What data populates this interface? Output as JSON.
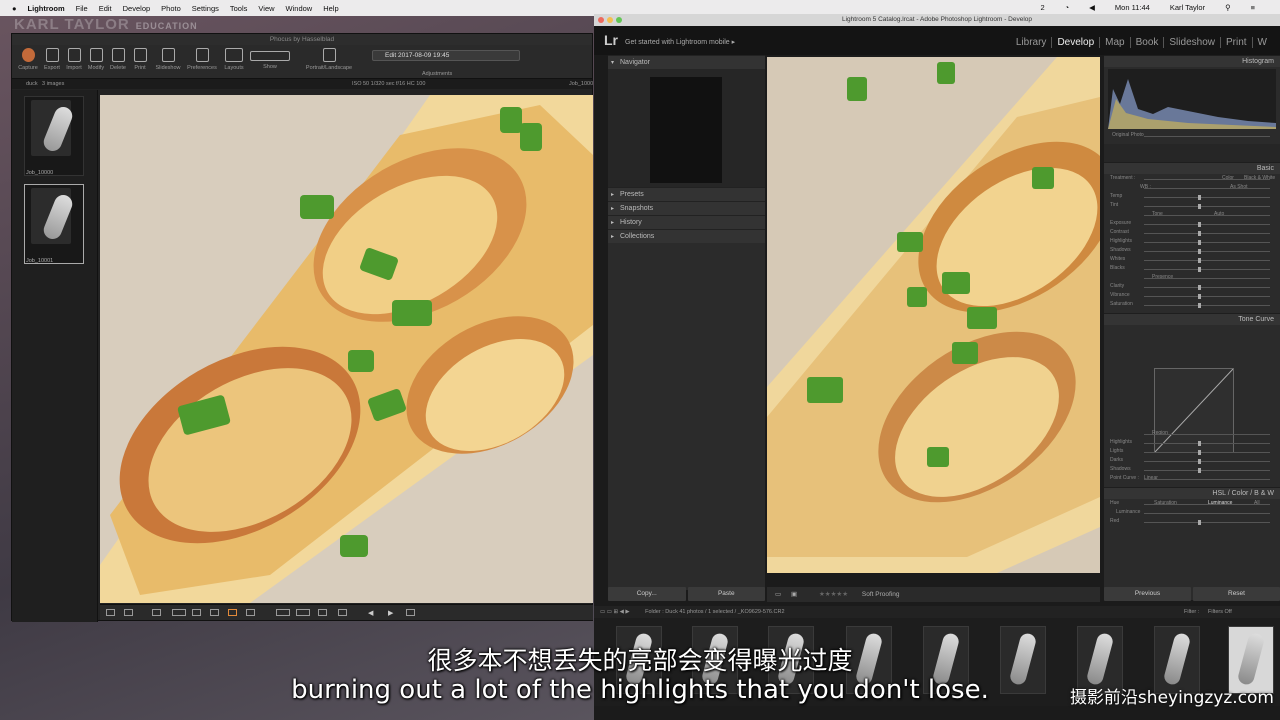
{
  "menubar": {
    "apple": "",
    "app": "Lightroom",
    "items": [
      "File",
      "Edit",
      "Develop",
      "Photo",
      "Settings",
      "Tools",
      "View",
      "Window",
      "Help"
    ],
    "clock": "Mon 11:44",
    "user": "Karl Taylor",
    "battery_count": "2"
  },
  "brand": {
    "name": "KARL TAYLOR",
    "sub": "EDUCATION"
  },
  "phocus": {
    "title": "Phocus by Hasselblad",
    "toolbar": [
      "Capture",
      "Export",
      "Import",
      "Modify",
      "Delete",
      "Print",
      "Slideshow",
      "Preferences",
      "Layouts",
      "Show",
      "Portrait/Landscape"
    ],
    "edit_label": "Edit 2017-08-09 19:45",
    "adjustments": "Adjustments",
    "folder": "duck",
    "image_count": "3 images",
    "meta": "ISO 50   1/320 sec   f/16   HC 100",
    "job_right": "Job_1000",
    "thumbs": [
      {
        "name": "Job_10000"
      },
      {
        "name": "Job_10001"
      }
    ]
  },
  "lightroom": {
    "title": "Lightroom 5 Catalog.lrcat - Adobe Photoshop Lightroom - Develop",
    "mobile": "Get started with Lightroom mobile",
    "modules": [
      "Library",
      "Develop",
      "Map",
      "Book",
      "Slideshow",
      "Print",
      "W"
    ],
    "active_module": "Develop",
    "left_panels": [
      "Navigator",
      "Presets",
      "Snapshots",
      "History",
      "Collections"
    ],
    "copy": "Copy...",
    "paste": "Paste",
    "soft_proofing": "Soft Proofing",
    "histogram": "Histogram",
    "original_photo": "Original Photo",
    "basic": "Basic",
    "treatment": "Treatment :",
    "color": "Color",
    "bw": "Black & White",
    "wb": "WB :",
    "as_shot": "As Shot",
    "tone": "Tone",
    "auto": "Auto",
    "tone_sliders": [
      "Temp",
      "Tint",
      "Exposure",
      "Contrast",
      "Highlights",
      "Shadows",
      "Whites",
      "Blacks",
      "Clarity",
      "Vibrance",
      "Saturation"
    ],
    "presence": "Presence",
    "tone_curve": "Tone Curve",
    "region": "Region",
    "curve_sliders": [
      "Highlights",
      "Lights",
      "Darks",
      "Shadows"
    ],
    "point_curve": "Point Curve :",
    "linear": "Linear",
    "hsl": "HSL / Color / B & W",
    "hsl_tabs": [
      "Hue",
      "Saturation",
      "Luminance",
      "All"
    ],
    "luminance": "Luminance",
    "red": "Red",
    "previous": "Previous",
    "reset": "Reset",
    "folder_info": "Folder : Duck     41 photos / 1 selected / _KO9629-576.CR2",
    "filter": "Filter :",
    "filters_off": "Filters Off"
  },
  "subtitles": {
    "cn": "很多本不想丢失的亮部会变得曝光过度",
    "en": "burning out a lot of the highlights that you don't lose."
  },
  "site": "摄影前沿sheyingzyz.com"
}
